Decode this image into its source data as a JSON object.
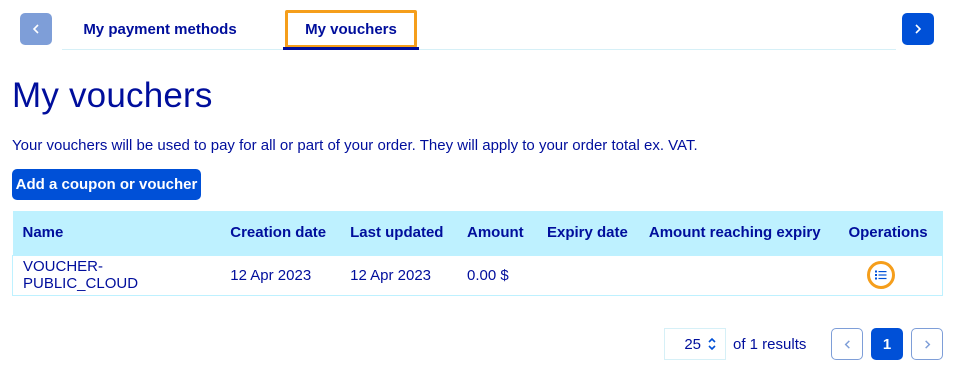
{
  "tabs": {
    "items": [
      {
        "label": "My payment methods",
        "active": false
      },
      {
        "label": "My vouchers",
        "active": true
      }
    ],
    "prev_icon": "chevron-left-icon",
    "next_icon": "chevron-right-icon"
  },
  "page": {
    "title": "My vouchers",
    "intro": "Your vouchers will be used to pay for all or part of your order. They will apply to your order total ex. VAT.",
    "add_button": "Add a coupon or voucher"
  },
  "table": {
    "columns": [
      "Name",
      "Creation date",
      "Last updated",
      "Amount",
      "Expiry date",
      "Amount reaching expiry",
      "Operations"
    ],
    "rows": [
      {
        "name": "VOUCHER-PUBLIC_CLOUD",
        "creation_date": "12 Apr 2023",
        "last_updated": "12 Apr 2023",
        "amount": "0.00 $",
        "expiry_date": "",
        "amount_reaching_expiry": "",
        "operations_icon": "list-icon"
      }
    ]
  },
  "pagination": {
    "per_page": "25",
    "results_text": "of 1 results",
    "current_page": "1"
  },
  "colors": {
    "primary": "#0050d7",
    "text": "#000e9c",
    "header_bg": "#bef1ff",
    "highlight": "#f59e1b"
  }
}
